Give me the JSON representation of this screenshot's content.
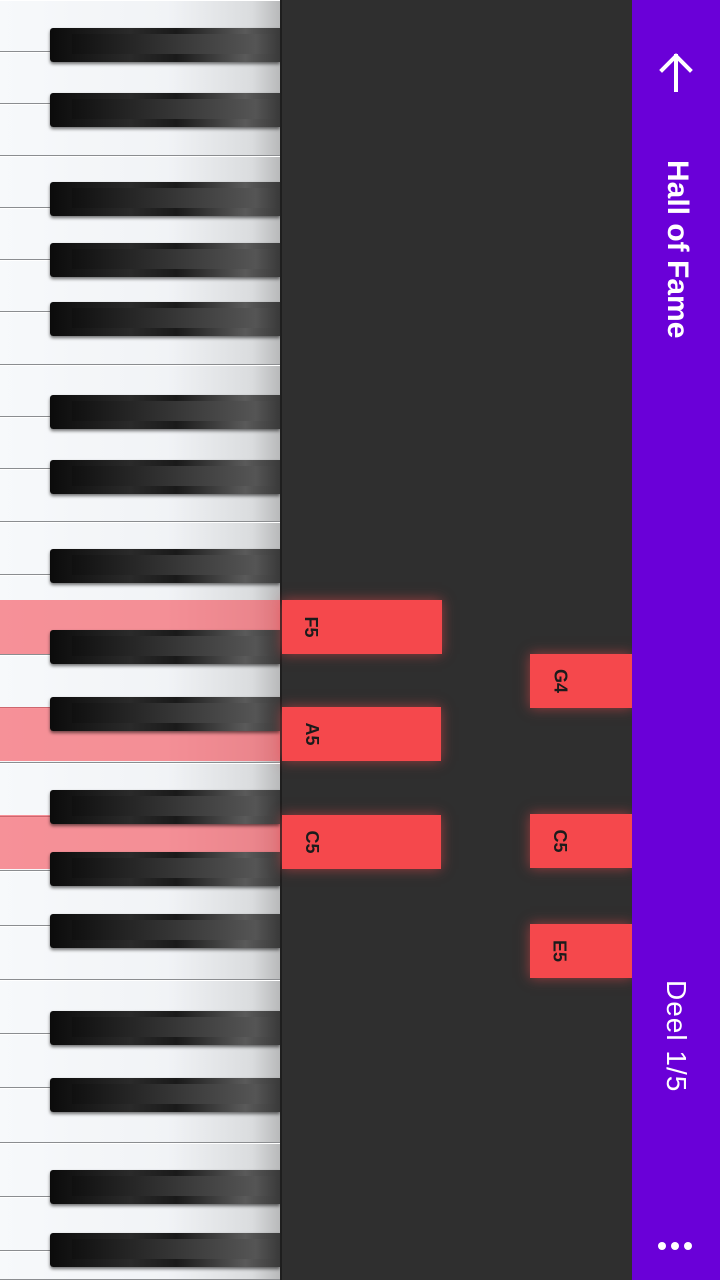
{
  "toolbar": {
    "title": "Hall of Fame",
    "subtitle": "Deel  1/5",
    "accent_color": "#6a00d8",
    "back_icon": "arrow-back-icon",
    "more_icon": "more-vertical-icon"
  },
  "notes": [
    {
      "label": "F5"
    },
    {
      "label": "A5"
    },
    {
      "label": "C5"
    },
    {
      "label": "G4"
    },
    {
      "label": "C5"
    },
    {
      "label": "E5"
    }
  ],
  "note_color": "#f5484c"
}
